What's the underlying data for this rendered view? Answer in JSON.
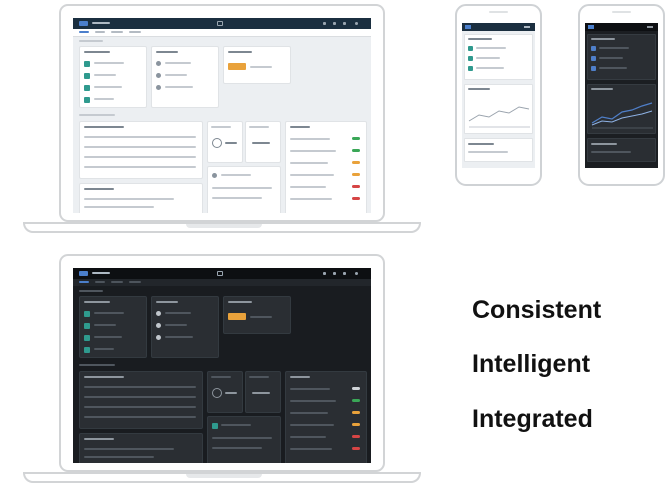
{
  "keywords": {
    "consistent": "Consistent",
    "intelligent": "Intelligent",
    "integrated": "Integrated"
  },
  "colors": {
    "light_shell_bar": "#1b2f40",
    "light_background": "#eceff2",
    "dark_background": "#191c20",
    "dark_panel": "#2a2e33",
    "accent_teal": "#2f9a8e",
    "accent_orange": "#e9a23b",
    "status_green": "#3aa757",
    "status_red": "#d64545",
    "chart_blue": "#4f7fc9"
  },
  "devices": [
    "laptop-light",
    "laptop-dark",
    "phone-light",
    "phone-dark"
  ]
}
